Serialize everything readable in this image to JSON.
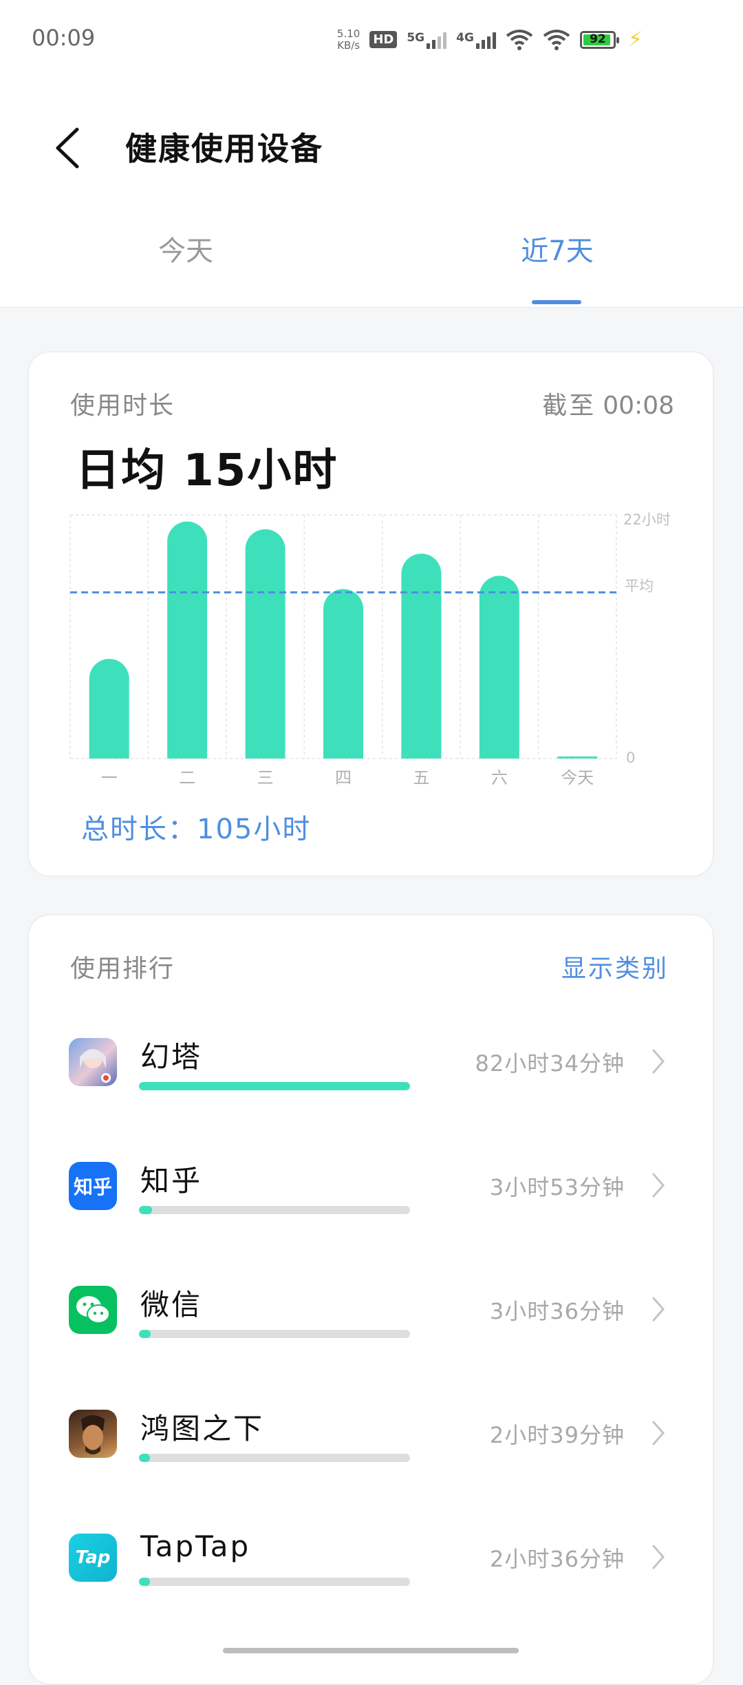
{
  "status_bar": {
    "time": "00:09",
    "net_speed_value": "5.10",
    "net_speed_unit": "KB/s",
    "hd_label": "HD",
    "sim1_label": "5G",
    "sim2_label": "4G",
    "battery_level": "92"
  },
  "header": {
    "title": "健康使用设备",
    "tabs": [
      {
        "label": "今天",
        "active": false
      },
      {
        "label": "近7天",
        "active": true
      }
    ]
  },
  "usage": {
    "label": "使用时长",
    "as_of_prefix": "截至",
    "as_of_time": "00:08",
    "daily_avg": "日均 15小时",
    "total": "总时长：105小时"
  },
  "chart_data": {
    "type": "bar",
    "categories": [
      "一",
      "二",
      "三",
      "四",
      "五",
      "六",
      "今天"
    ],
    "values": [
      9,
      21.4,
      20.7,
      15.3,
      18.5,
      16.5,
      0.1
    ],
    "unit": "小时",
    "ylim": [
      0,
      22
    ],
    "y_tick_labels": {
      "max": "22小时",
      "min": "0"
    },
    "average_value": 15,
    "average_label": "平均",
    "bar_color": "#3ee0bb",
    "average_line_color": "#4f8ee0"
  },
  "ranking": {
    "label": "使用排行",
    "show_category": "显示类别",
    "apps": [
      {
        "name": "幻塔",
        "time": "82小时34分钟",
        "share": 1.0,
        "icon": "tower-of-fantasy-icon"
      },
      {
        "name": "知乎",
        "time": "3小时53分钟",
        "share": 0.047,
        "icon": "zhihu-icon",
        "icon_text": "知乎"
      },
      {
        "name": "微信",
        "time": "3小时36分钟",
        "share": 0.044,
        "icon": "wechat-icon"
      },
      {
        "name": "鸿图之下",
        "time": "2小时39分钟",
        "share": 0.032,
        "icon": "hongtu-icon"
      },
      {
        "name": "TapTap",
        "time": "2小时36分钟",
        "share": 0.031,
        "icon": "taptap-icon",
        "icon_text": "Tap"
      }
    ]
  },
  "colors": {
    "accent": "#4f8ee0",
    "bar": "#3ee0bb"
  }
}
